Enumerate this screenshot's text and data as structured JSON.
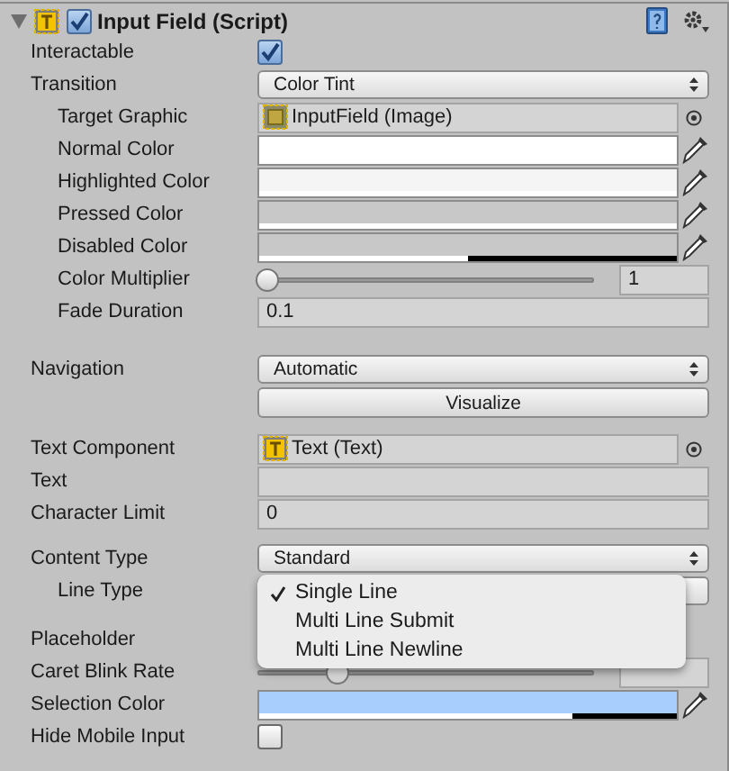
{
  "component": {
    "title": "Input Field (Script)",
    "enabled": true
  },
  "fields": [
    {
      "kind": "checkbox",
      "label": "Interactable",
      "checked": true
    },
    {
      "kind": "dropdown",
      "label": "Transition",
      "value": "Color Tint"
    },
    {
      "kind": "object",
      "label": "Target Graphic",
      "value": "InputField (Image)",
      "indent": true
    },
    {
      "kind": "color",
      "label": "Normal Color",
      "color": "#ffffff",
      "level": 1,
      "indent": true
    },
    {
      "kind": "color",
      "label": "Highlighted Color",
      "color": "#f5f5f5",
      "level": 1,
      "indent": true
    },
    {
      "kind": "color",
      "label": "Pressed Color",
      "color": "#c8c8c8",
      "level": 1,
      "indent": true
    },
    {
      "kind": "color",
      "label": "Disabled Color",
      "color": "#c8c8c8",
      "level": 0.5,
      "indent": true
    },
    {
      "kind": "slider",
      "label": "Color Multiplier",
      "level": 0,
      "reading": "1",
      "indent": true
    },
    {
      "kind": "number",
      "label": "Fade Duration",
      "value": "0.1",
      "indent": true
    },
    {
      "kind": "spacer"
    },
    {
      "kind": "dropdown",
      "label": "Navigation",
      "value": "Automatic"
    },
    {
      "kind": "button",
      "value": "Visualize"
    },
    {
      "kind": "spacer"
    },
    {
      "kind": "object",
      "label": "Text Component",
      "value": "Text (Text)"
    },
    {
      "kind": "number",
      "label": "Text"
    },
    {
      "kind": "number",
      "label": "Character Limit",
      "value": "0"
    },
    {
      "kind": "spacer"
    },
    {
      "kind": "dropdown",
      "label": "Content Type",
      "value": "Standard"
    },
    {
      "kind": "popup",
      "label": "Line Type",
      "indent": true,
      "options": [
        {
          "label": "Single Line",
          "selected": true
        },
        {
          "label": "Multi Line Submit",
          "selected": false
        },
        {
          "label": "Multi Line Newline",
          "selected": false
        }
      ]
    },
    {
      "kind": "spacer"
    },
    {
      "kind": "hidden",
      "label": "Placeholder"
    },
    {
      "kind": "slider",
      "label": "Caret Blink Rate",
      "level": 0.21
    },
    {
      "kind": "color",
      "label": "Selection Color",
      "color": "#a8cefe",
      "level": 0.75
    },
    {
      "kind": "checkbox",
      "label": "Hide Mobile Input",
      "checked": false
    }
  ]
}
